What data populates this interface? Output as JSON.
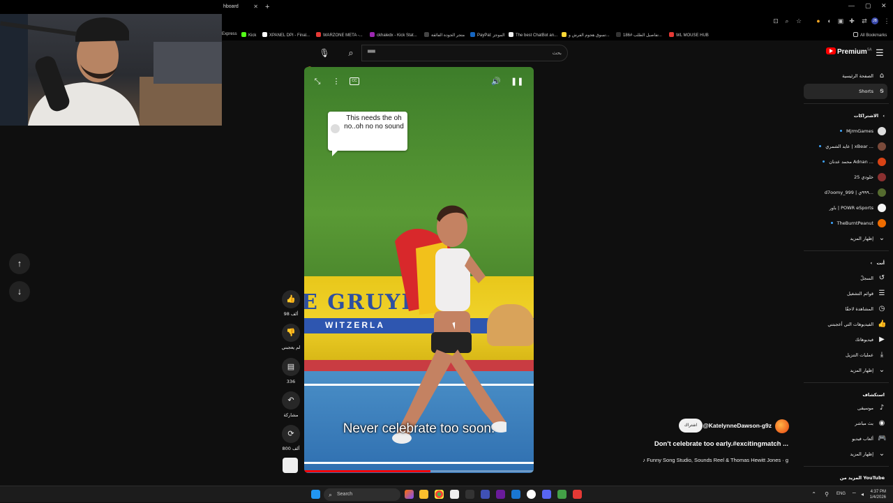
{
  "browser": {
    "tab_label": "hboard",
    "tab_close": "✕",
    "new_tab": "+",
    "all_bookmarks": "All Bookmarks",
    "bookmarks": [
      {
        "label": "Express",
        "color": "#888888"
      },
      {
        "label": "Kick",
        "color": "#53fc18"
      },
      {
        "label": "XPANEL DPI - Final...",
        "color": "#ffffff"
      },
      {
        "label": "WARZONE META -...",
        "color": "#e53935"
      },
      {
        "label": "ckhaledx - Kick Stat...",
        "color": "#9c27b0"
      },
      {
        "label": "متجر الجودة الفائقة",
        "color": "#444444"
      },
      {
        "label": "PayPal: الموجز",
        "color": "#1565c0"
      },
      {
        "label": "The best ChatBot an...",
        "color": "#eeeeee"
      },
      {
        "label": "تسوق هجوم الفرش و...",
        "color": "#fdd835"
      },
      {
        "label": "تفاصيل الطلب #186...",
        "color": "#333333"
      },
      {
        "label": "WL MOUSE HUB",
        "color": "#e53935"
      }
    ]
  },
  "header": {
    "search_placeholder": "بحث",
    "search_value": "▀▀",
    "logo_text": "Premium",
    "logo_region": "SA"
  },
  "sidebar": {
    "nav": [
      {
        "label": "الصفحة الرئيسية",
        "icon": "home-icon",
        "glyph": "⌂"
      },
      {
        "label": "Shorts",
        "icon": "shorts-icon",
        "glyph": "ᵴ",
        "active": true
      }
    ],
    "subscriptions_heading": "الاشتراكات",
    "subscriptions": [
      {
        "label": "MjrmGames",
        "dot": true,
        "color": "#dddddd"
      },
      {
        "label": "عايد الشمري | xBear ...",
        "dot": true,
        "color": "#7a4a3a"
      },
      {
        "label": "محمد عدنان Adnan ...",
        "dot": true,
        "color": "#d84315"
      },
      {
        "label": "خلودي 25",
        "dot": false,
        "color": "#8a3030"
      },
      {
        "label": "d7oomy_999 | ٩٩٩ي...",
        "dot": false,
        "color": "#556b2f"
      },
      {
        "label": "باور | POWR eSports",
        "dot": false,
        "color": "#f5f5f5"
      },
      {
        "label": "TheBurntPeanut",
        "dot": true,
        "color": "#ef6c00"
      }
    ],
    "subs_show_more": "إظهار المزيد",
    "you_heading": "أنت",
    "you_items": [
      {
        "label": "السجلّ",
        "glyph": "↺",
        "icon": "history-icon"
      },
      {
        "label": "قوائم التشغيل",
        "glyph": "☰",
        "icon": "playlists-icon"
      },
      {
        "label": "المشاهدة لاحقًا",
        "glyph": "◷",
        "icon": "watch-later-icon"
      },
      {
        "label": "الفيديوهات التي أعجبتني",
        "glyph": "👍",
        "icon": "liked-icon"
      },
      {
        "label": "فيديوهاتك",
        "glyph": "▶",
        "icon": "your-videos-icon"
      },
      {
        "label": "عمليات التنزيل",
        "glyph": "⤓",
        "icon": "downloads-icon"
      }
    ],
    "you_show_more": "إظهار المزيد",
    "explore_heading": "استكشاف",
    "explore_items": [
      {
        "label": "موسيقى",
        "glyph": "♪",
        "icon": "music-icon"
      },
      {
        "label": "بث مباشر",
        "glyph": "◉",
        "icon": "live-icon"
      },
      {
        "label": "ألعاب فيديو",
        "glyph": "🎮",
        "icon": "gaming-icon"
      }
    ],
    "explore_show_more": "إظهار المزيد",
    "more_from": "المزيد من YouTube"
  },
  "video": {
    "reaction_emoji": "😂",
    "caption_bubble": "This needs the oh no..oh no no sound",
    "banner_text": "E GRUYÈ",
    "banner_sub": "WITZERLA",
    "subtitle": "Never celebrate too soon.",
    "progress": 0.55
  },
  "actions": {
    "like_count": "98 ألف",
    "dislike_label": "لم يعجبني",
    "comment_count": "336",
    "share_label": "مشاركة",
    "remix_count": "800 ألف"
  },
  "channel": {
    "name": "@KatelynneDawson-g9z",
    "subscribe_label": "اشتراك",
    "title": "Don't celebrate too early.#excitingmatch ...",
    "music": "♪ Funny Song Studio, Sounds Reel & Thomas Hewitt Jones · g"
  },
  "taskbar": {
    "search_label": "Search",
    "lang": "ENG",
    "time": "4:37 PM",
    "date": "1/4/2026"
  }
}
